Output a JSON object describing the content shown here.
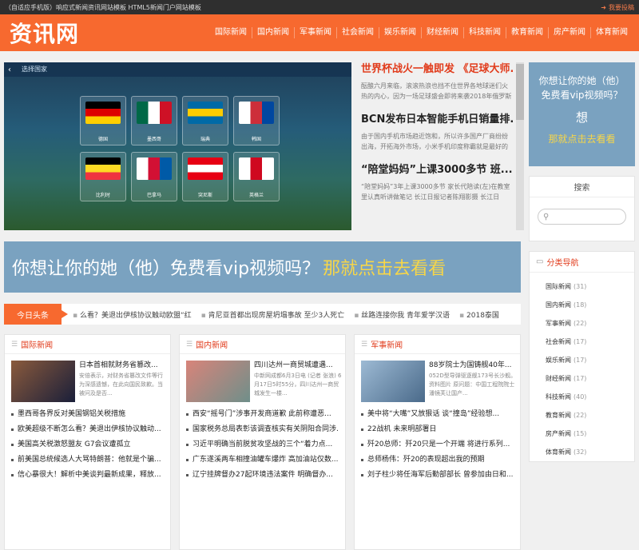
{
  "topbar": {
    "left_text": "（自适应手机版）响应式新闻资讯网站模板 HTML5新闻门户网站模板",
    "submit_label": "我要投稿"
  },
  "header": {
    "logo": "资讯网",
    "nav": [
      "国际新闻",
      "国内新闻",
      "军事新闻",
      "社会新闻",
      "娱乐新闻",
      "财经新闻",
      "科技新闻",
      "教育新闻",
      "房产新闻",
      "体育新闻"
    ]
  },
  "slider": {
    "header_text": "选择国家",
    "flags": [
      {
        "label": "德国",
        "colors": [
          "#000000",
          "#dd0000",
          "#ffce00"
        ]
      },
      {
        "label": "墨西哥",
        "colors": [
          "#006847",
          "#ffffff",
          "#ce1126"
        ]
      },
      {
        "label": "瑞典",
        "colors": [
          "#006aa7",
          "#fecc00",
          "#006aa7"
        ]
      },
      {
        "label": "韩国",
        "colors": [
          "#ffffff",
          "#cd2e3a",
          "#0047a0"
        ]
      },
      {
        "label": "比利时",
        "colors": [
          "#000000",
          "#fdda24",
          "#ef3340"
        ]
      },
      {
        "label": "巴拿马",
        "colors": [
          "#ffffff",
          "#d21034",
          "#005aa7"
        ]
      },
      {
        "label": "突尼斯",
        "colors": [
          "#e70013",
          "#ffffff",
          "#e70013"
        ]
      },
      {
        "label": "英格兰",
        "colors": [
          "#ffffff",
          "#cf081f",
          "#ffffff"
        ]
      }
    ]
  },
  "headlines": [
    {
      "title": "世界杯战火一触即发 《足球大师...",
      "desc": "酝酿六月来临，滚滚热浪也挡不住世界各地球迷们火热的内心，因为一场足球盛会即将来袭2018年俄罗斯世界",
      "highlight": true
    },
    {
      "title": "BCN发布日本智能手机日销量排...",
      "desc": "由于国内手机市场趋近饱和，所以许多国产厂商纷纷出海，开拓海外市场，小米手机印度称霸就是最好的",
      "highlight": false
    },
    {
      "title": "“陪堂妈妈”上课3000多节 班...",
      "desc": "“陪堂妈妈”3年上课3000多节 家长代陪读(左)在教室里认真听讲做笔记 长江日报记者陈翔影摄 长江日",
      "highlight": false
    }
  ],
  "banner": {
    "part1": "你想让你的她（他）免费看vip视频吗？",
    "part2": "那就点击去看看"
  },
  "ticker": {
    "label": "今日头条",
    "items": [
      "么看？美退出伊核协议触动欧盟“红",
      "肯尼亚首都出现房屋坍塌事故 至少3人死亡",
      "丝路连接你我 青年爱学汉语",
      "2018泰国"
    ]
  },
  "columns": [
    {
      "title": "国际新闻",
      "feature_title": "日本首相就财务省篡改...",
      "feature_desc": "安倍表示，对财务省篡改文件等行为深感遗憾，在此向国民致歉。当被问及是否...",
      "thumb_colors": [
        "#8a5a3c",
        "#1a1f3a"
      ],
      "items": [
        "墨西哥各界反对美国钢铝关税措施",
        "欧美超级不断怎么看？美退出伊核协议触动...",
        "美国高关税激怒盟友 G7会议遭孤立",
        "前美国总统候选人大骂特朗普：他就是个骗...",
        "信心暴很大！解析中美谈判最新成果，释放..."
      ]
    },
    {
      "title": "国内新闻",
      "feature_title": "四川达州一商贸城遭遇...",
      "feature_desc": "中新网成都6月3日电 (记者 张浪) 6月17日5时55分，四川达州一商贸城发生一楼...",
      "thumb_colors": [
        "#d8847a",
        "#6f8f8a"
      ],
      "items": [
        "西安“摇号门”涉事开发商道歉 此前称遭恶...",
        "国家税务总局表彰该调查核实有关阴阳合同涉...",
        "习近平明确当前脱贫攻坚战的三个“着力点...",
        "广东遂溪两车相撞油罐车爆炸 高加油站仅数...",
        "辽宁挂牌督办27起环境违法案件 明确督办..."
      ]
    },
    {
      "title": "军事新闻",
      "feature_title": "88岁院士为国铸舰40年...",
      "feature_desc": "052D型导弹驱逐舰173号长沙舰。资料图片 原问题：中国工程院院士潘镜芙让国产...",
      "thumb_colors": [
        "#9dbad4",
        "#4a6a8a"
      ],
      "items": [
        "美中将“大嘴”又放狠话 谈“撞岛”经验想...",
        "22战机 未来明部署日",
        "歼20总师：歼20只是一个开端 将进行系列...",
        "总师杨伟：歼20的表现超出我的预期",
        "刘子柱少将任海军后勤部部长 曾参加由日和..."
      ]
    }
  ],
  "sidebar": {
    "ad": {
      "line1": "你想让你的她（他）免费看vip视频吗？",
      "line2": "想",
      "line3": "那就点击去看看"
    },
    "search_title": "搜索",
    "categories_title": "分类导航",
    "categories": [
      {
        "name": "国际新闻",
        "count": "(31)"
      },
      {
        "name": "国内新闻",
        "count": "(18)"
      },
      {
        "name": "军事新闻",
        "count": "(22)"
      },
      {
        "name": "社会新闻",
        "count": "(17)"
      },
      {
        "name": "娱乐新闻",
        "count": "(17)"
      },
      {
        "name": "财经新闻",
        "count": "(17)"
      },
      {
        "name": "科技新闻",
        "count": "(40)"
      },
      {
        "name": "教育新闻",
        "count": "(22)"
      },
      {
        "name": "房产新闻",
        "count": "(15)"
      },
      {
        "name": "体育新闻",
        "count": "(32)"
      }
    ]
  }
}
